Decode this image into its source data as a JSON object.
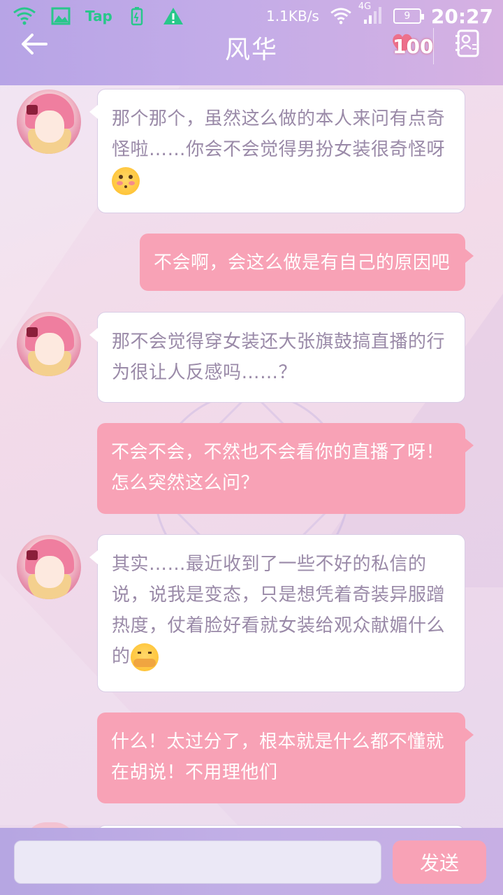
{
  "status_bar": {
    "speed": "1.1KB/s",
    "network": "4G",
    "battery": "9",
    "time": "20:27",
    "tap_label": "Tap",
    "icons": [
      "wifi-icon",
      "image-icon",
      "tap-icon",
      "battery-charging-icon",
      "warning-icon",
      "wifi-icon",
      "cell-signal-icon"
    ]
  },
  "header": {
    "title": "风华",
    "affection": "100",
    "back_icon": "arrow-left-icon",
    "contacts_icon": "contacts-card-icon"
  },
  "messages": [
    {
      "from": "them",
      "text": "那个那个，虽然这么做的本人来问有点奇怪啦……你会不会觉得男扮女装很奇怪呀",
      "emoji": "flushed-face-emoji"
    },
    {
      "from": "me",
      "text": "不会啊，会这么做是有自己的原因吧"
    },
    {
      "from": "them",
      "text": "那不会觉得穿女装还大张旗鼓搞直播的行为很让人反感吗……？"
    },
    {
      "from": "me",
      "text": "不会不会，不然也不会看你的直播了呀！怎么突然这么问？"
    },
    {
      "from": "them",
      "text": "其实……最近收到了一些不好的私信的说，说我是变态，只是想凭着奇装异服蹭热度，仗着脸好看就女装给观众献媚什么的",
      "emoji": "hugging-face-emoji"
    },
    {
      "from": "me",
      "text": "什么！太过分了，根本就是什么都不懂就在胡说！不用理他们"
    }
  ],
  "input": {
    "value": "",
    "placeholder": "",
    "send_label": "发送"
  },
  "colors": {
    "header_bg": "#b7a4e6",
    "outgoing_bubble": "#f8a2b6",
    "incoming_text": "#9a8aa8",
    "status_green": "#28c78a"
  }
}
